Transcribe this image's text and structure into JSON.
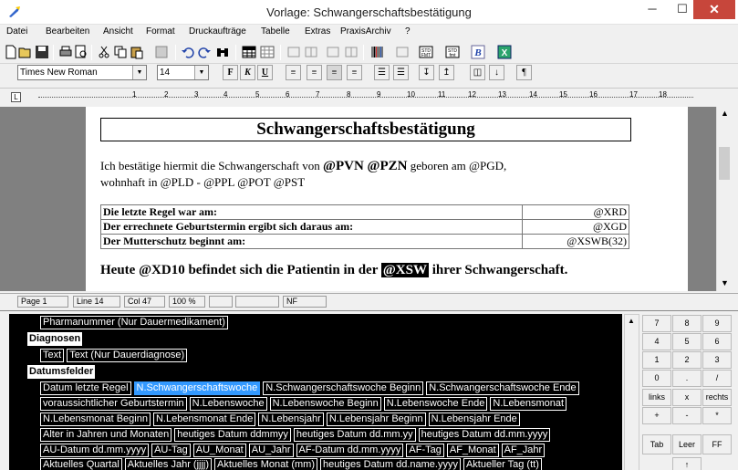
{
  "window": {
    "title": "Vorlage: Schwangerschaftsbestätigung",
    "min": "─",
    "max": "☐",
    "close": "✕"
  },
  "menu": [
    "Datei",
    "Bearbeiten",
    "Ansicht",
    "Format",
    "Druckaufträge",
    "Tabelle",
    "Extras",
    "PraxisArchiv",
    "?"
  ],
  "toolbar": {
    "icons": [
      "new-document-icon",
      "open-folder-icon",
      "save-icon",
      "print-icon",
      "print-preview-icon",
      "cut-icon",
      "copy-icon",
      "paste-icon",
      "undo-icon",
      "redo-icon",
      "find-icon",
      "table-icon",
      "grid-icon",
      "insert-row-icon",
      "insert-col-icon",
      "delete-row-icon",
      "delete-col-icon",
      "barcode-icon",
      "image-icon",
      "field-std-icon",
      "field-std2-icon",
      "script-icon",
      "excel-icon"
    ],
    "std1": "STD\nFMT",
    "std2": "STD\nfmt"
  },
  "format": {
    "font": "Times New Roman",
    "size": "14",
    "bold": "F",
    "italic": "K",
    "underline": "U"
  },
  "ruler": {
    "tab_selector": "L",
    "numbers": [
      "1",
      "2",
      "3",
      "4",
      "5",
      "6",
      "7",
      "8",
      "9",
      "10",
      "11",
      "12",
      "13",
      "14",
      "15",
      "16",
      "17",
      "18"
    ]
  },
  "document": {
    "heading": "Schwangerschaftsbestätigung",
    "para_line1_a": "Ich bestätige hiermit die Schwangerschaft von ",
    "para_line1_b": "@PVN @PZN",
    "para_line1_c": " geboren am @PGD,",
    "para_line2": "wohnhaft in @PLD - @PPL @POT @PST",
    "table": [
      {
        "label": "Die letzte Regel war am:",
        "value": "@XRD"
      },
      {
        "label": "Der errechnete Geburtstermin ergibt sich daraus am:",
        "value": "@XGD"
      },
      {
        "label": "Der Mutterschutz beginnt am:",
        "value": "@XSWB(32)"
      }
    ],
    "big_a": "Heute @XD10 befindet sich die Patientin in der ",
    "big_hl": "@XSW",
    "big_b": " ihrer Schwangerschaft."
  },
  "status": {
    "page": "Page  1",
    "line": "Line 14",
    "col": "Col 47",
    "zoom": "100 %",
    "mode": "NF"
  },
  "fields": {
    "row0": [
      "Pharmanummer (Nur Dauermedikament)"
    ],
    "cat_diag": "Diagnosen",
    "row_diag": [
      "Text",
      "Text (Nur Dauerdiagnose)"
    ],
    "cat_date": "Datumsfelder",
    "r1": [
      "Datum letzte Regel",
      "N.Schwangerschaftswoche",
      "N.Schwangerschaftswoche Beginn",
      "N.Schwangerschaftswoche Ende"
    ],
    "r2": [
      "voraussichtlicher Geburtstermin",
      "N.Lebenswoche",
      "N.Lebenswoche Beginn",
      "N.Lebenswoche Ende",
      "N.Lebensmonat"
    ],
    "r3": [
      "N.Lebensmonat Beginn",
      "N.Lebensmonat Ende",
      "N.Lebensjahr",
      "N.Lebensjahr Beginn",
      "N.Lebensjahr Ende"
    ],
    "r4": [
      "Alter in Jahren und Monaten",
      "heutiges Datum ddmmyy",
      "heutiges Datum dd.mm.yy",
      "heutiges Datum dd.mm.yyyy"
    ],
    "r5": [
      "AU-Datum dd.mm.yyyy",
      "AU-Tag",
      "AU_Monat",
      "AU_Jahr",
      "AF-Datum dd.mm.yyyy",
      "AF-Tag",
      "AF_Monat",
      "AF_Jahr"
    ],
    "r6": [
      "Aktuelles Quartal",
      "Aktuelles Jahr (jjjj)",
      "Aktuelles Monat (mm)",
      "heutiges Datum dd.name.yyyy",
      "Aktueller Tag (tt)"
    ]
  },
  "numpad": {
    "keys": [
      "7",
      "8",
      "9",
      "4",
      "5",
      "6",
      "1",
      "2",
      "3",
      "0",
      ".",
      "/",
      "links",
      "x",
      "rechts",
      "+",
      "-",
      "*"
    ],
    "bottom": [
      "Tab",
      "Leer",
      "FF"
    ],
    "up": "↑"
  }
}
